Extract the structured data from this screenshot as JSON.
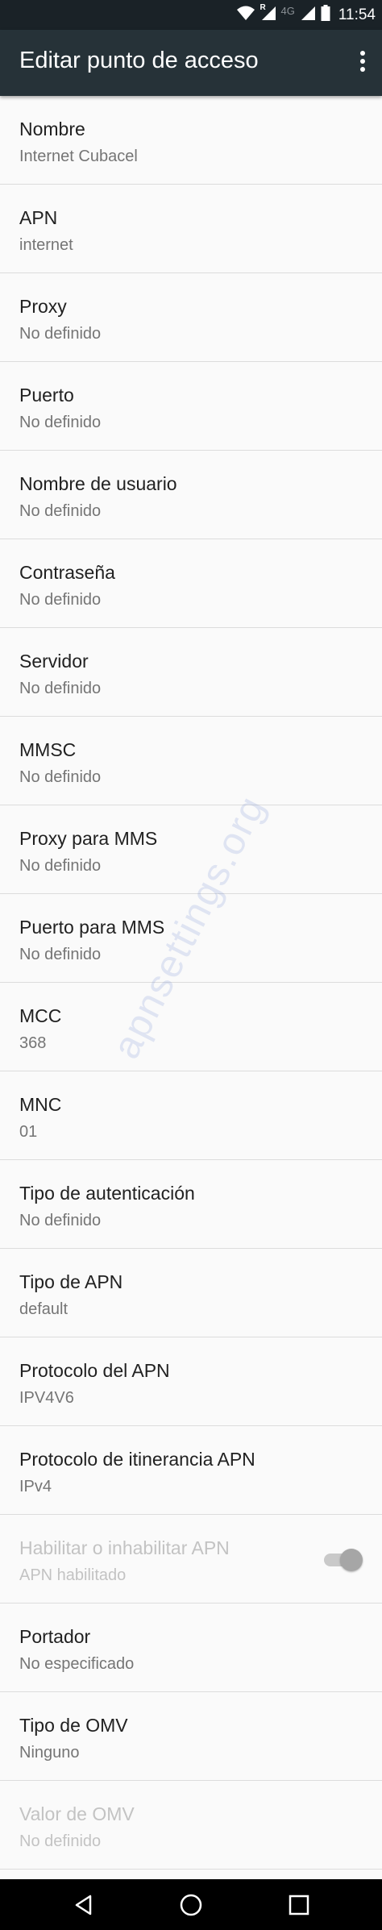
{
  "status_bar": {
    "network": "4G",
    "roaming": "R",
    "time": "11:54"
  },
  "toolbar": {
    "title": "Editar punto de acceso",
    "menu_icon": "more-vert-icon"
  },
  "fields": [
    {
      "label": "Nombre",
      "value": "Internet Cubacel"
    },
    {
      "label": "APN",
      "value": "internet"
    },
    {
      "label": "Proxy",
      "value": "No definido"
    },
    {
      "label": "Puerto",
      "value": "No definido"
    },
    {
      "label": "Nombre de usuario",
      "value": "No definido"
    },
    {
      "label": "Contraseña",
      "value": "No definido"
    },
    {
      "label": "Servidor",
      "value": "No definido"
    },
    {
      "label": "MMSC",
      "value": "No definido"
    },
    {
      "label": "Proxy para MMS",
      "value": "No definido"
    },
    {
      "label": "Puerto para MMS",
      "value": "No definido"
    },
    {
      "label": "MCC",
      "value": "368"
    },
    {
      "label": "MNC",
      "value": "01"
    },
    {
      "label": "Tipo de autenticación",
      "value": "No definido"
    },
    {
      "label": "Tipo de APN",
      "value": "default"
    },
    {
      "label": "Protocolo del APN",
      "value": "IPV4V6"
    },
    {
      "label": "Protocolo de itinerancia APN",
      "value": "IPv4"
    },
    {
      "label": "Habilitar o inhabilitar APN",
      "value": "APN habilitado",
      "toggle": true,
      "enabled": false
    },
    {
      "label": "Portador",
      "value": "No especificado"
    },
    {
      "label": "Tipo de OMV",
      "value": "Ninguno"
    },
    {
      "label": "Valor de OMV",
      "value": "No definido",
      "enabled": false
    }
  ],
  "watermark": "apnsettings.org",
  "nav_bar": {
    "back_icon": "back-icon",
    "home_icon": "home-icon",
    "recents_icon": "recents-icon"
  }
}
